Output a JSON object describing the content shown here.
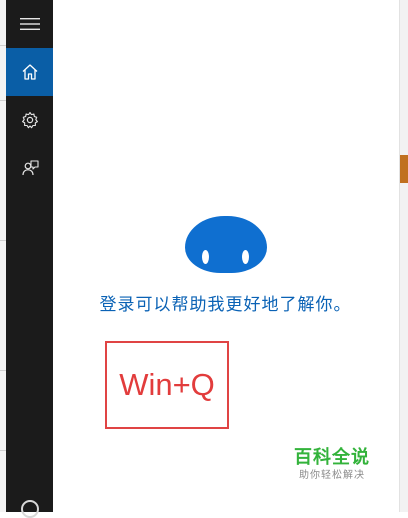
{
  "nav": {
    "items": [
      {
        "name": "menu",
        "icon": "hamburger-menu-icon",
        "active": false
      },
      {
        "name": "home",
        "icon": "home-icon",
        "active": true
      },
      {
        "name": "settings",
        "icon": "gear-icon",
        "active": false
      },
      {
        "name": "feedback",
        "icon": "feedback-icon",
        "active": false
      }
    ],
    "active_color": "#0a5ea6",
    "rail_color": "#1b1b1b"
  },
  "main": {
    "avatar_icon": "cortana-face-icon",
    "signin_text": "登录可以帮助我更好地了解你。",
    "annotation_text": "Win+Q",
    "annotation_color": "#e23c3c"
  },
  "watermark": {
    "title": "百科全说",
    "subtitle": "助你轻松解决"
  },
  "colors": {
    "brand_blue": "#0f6fd0",
    "watermark_green": "#33b33b"
  }
}
